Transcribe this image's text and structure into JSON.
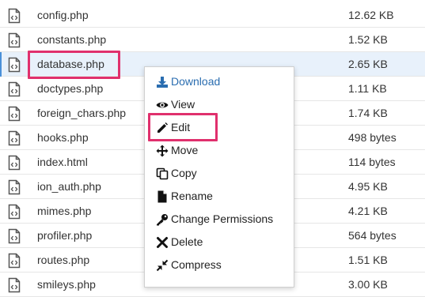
{
  "files": [
    {
      "name": "config.php",
      "size": "12.62 KB"
    },
    {
      "name": "constants.php",
      "size": "1.52 KB"
    },
    {
      "name": "database.php",
      "size": "2.65 KB",
      "selected": true
    },
    {
      "name": "doctypes.php",
      "size": "1.11 KB"
    },
    {
      "name": "foreign_chars.php",
      "size": "1.74 KB"
    },
    {
      "name": "hooks.php",
      "size": "498 bytes"
    },
    {
      "name": "index.html",
      "size": "114 bytes"
    },
    {
      "name": "ion_auth.php",
      "size": "4.95 KB"
    },
    {
      "name": "mimes.php",
      "size": "4.21 KB"
    },
    {
      "name": "profiler.php",
      "size": "564 bytes"
    },
    {
      "name": "routes.php",
      "size": "1.51 KB"
    },
    {
      "name": "smileys.php",
      "size": "3.00 KB"
    }
  ],
  "context_menu": {
    "items": [
      {
        "label": "Download",
        "icon": "download-icon"
      },
      {
        "label": "View",
        "icon": "eye-icon"
      },
      {
        "label": "Edit",
        "icon": "pencil-icon"
      },
      {
        "label": "Move",
        "icon": "move-arrows-icon"
      },
      {
        "label": "Copy",
        "icon": "copy-icon"
      },
      {
        "label": "Rename",
        "icon": "file-icon"
      },
      {
        "label": "Change Permissions",
        "icon": "key-icon"
      },
      {
        "label": "Delete",
        "icon": "close-icon"
      },
      {
        "label": "Compress",
        "icon": "compress-icon"
      }
    ]
  },
  "colors": {
    "accent": "#2a6db0",
    "highlight": "#e0306d",
    "selected_row": "#e8f1fb"
  }
}
